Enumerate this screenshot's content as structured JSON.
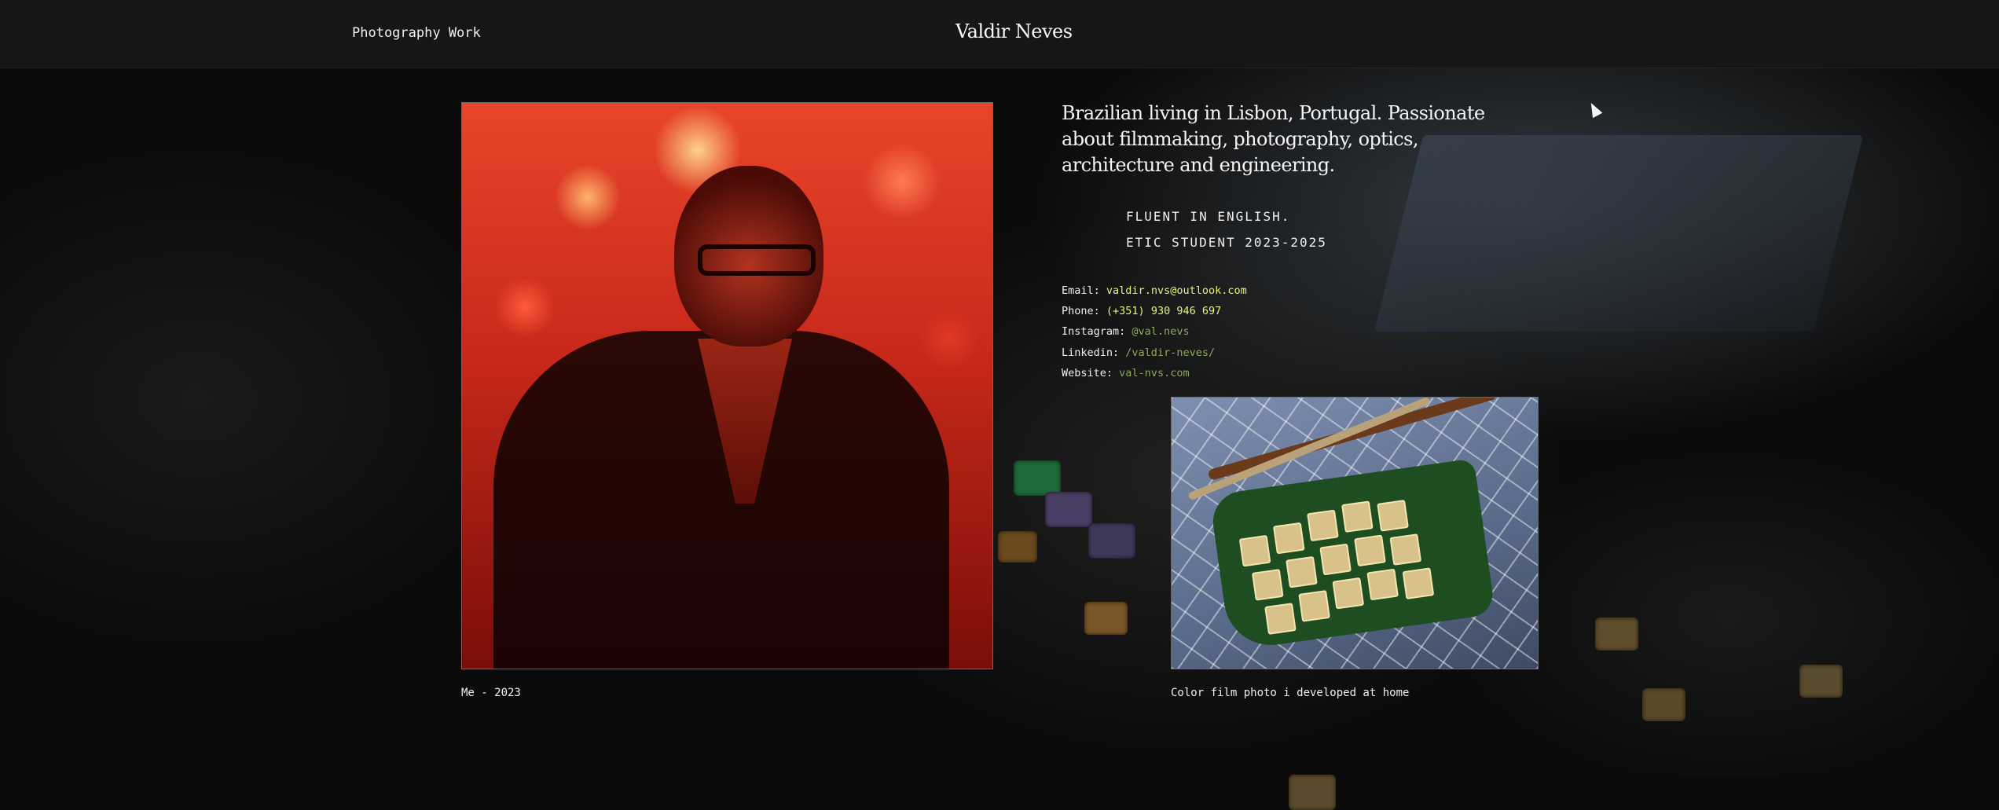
{
  "header": {
    "nav_link": "Photography Work",
    "brand": "Valdir Neves"
  },
  "intro": "Brazilian living in Lisbon, Portugal. Passionate about filmmaking, photography, optics, architecture and engineering.",
  "facts": [
    "FLUENT IN ENGLISH.",
    "ETIC STUDENT 2023-2025"
  ],
  "contacts": [
    {
      "label": "Email:",
      "value": "valdir.nvs@outlook.com",
      "color": "#e9f27a"
    },
    {
      "label": "Phone:",
      "value": "(+351) 930 946 697",
      "color": "#e9f27a"
    },
    {
      "label": "Instagram:",
      "value": "@val.nevs",
      "color": "#8fa85a"
    },
    {
      "label": "Linkedin:",
      "value": "/valdir-neves/",
      "color": "#8fa85a"
    },
    {
      "label": "Website:",
      "value": "val-nvs.com",
      "color": "#8fa85a"
    }
  ],
  "captions": {
    "main": "Me - 2023",
    "side": "Color film photo i developed at home"
  }
}
